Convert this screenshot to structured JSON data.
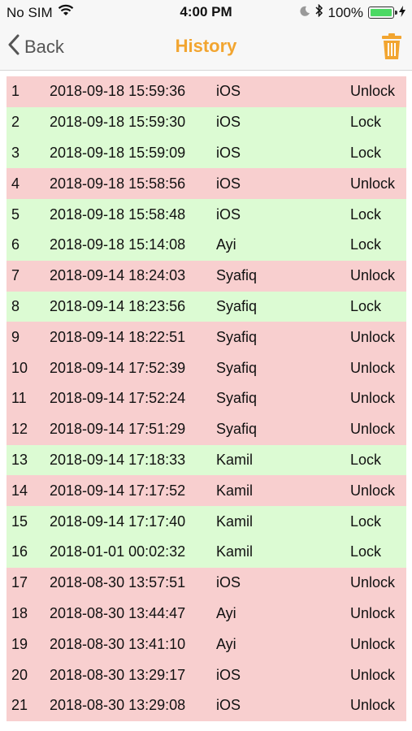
{
  "status_bar": {
    "carrier": "No SIM",
    "time": "4:00 PM",
    "battery": "100%",
    "battery_fill": 1.0
  },
  "nav": {
    "back_label": "Back",
    "title": "History"
  },
  "colors": {
    "accent": "#f2a530",
    "unlock_row": "#f8cfcf",
    "lock_row": "#dcfbd3"
  },
  "rows": [
    {
      "num": "1",
      "datetime": "2018-09-18 15:59:36",
      "user": "iOS",
      "action": "Unlock"
    },
    {
      "num": "2",
      "datetime": "2018-09-18 15:59:30",
      "user": "iOS",
      "action": "Lock"
    },
    {
      "num": "3",
      "datetime": "2018-09-18 15:59:09",
      "user": "iOS",
      "action": "Lock"
    },
    {
      "num": "4",
      "datetime": "2018-09-18 15:58:56",
      "user": "iOS",
      "action": "Unlock"
    },
    {
      "num": "5",
      "datetime": "2018-09-18 15:58:48",
      "user": "iOS",
      "action": "Lock"
    },
    {
      "num": "6",
      "datetime": "2018-09-18 15:14:08",
      "user": "Ayi",
      "action": "Lock"
    },
    {
      "num": "7",
      "datetime": "2018-09-14 18:24:03",
      "user": "Syafiq",
      "action": "Unlock"
    },
    {
      "num": "8",
      "datetime": "2018-09-14 18:23:56",
      "user": "Syafiq",
      "action": "Lock"
    },
    {
      "num": "9",
      "datetime": "2018-09-14 18:22:51",
      "user": "Syafiq",
      "action": "Unlock"
    },
    {
      "num": "10",
      "datetime": "2018-09-14 17:52:39",
      "user": "Syafiq",
      "action": "Unlock"
    },
    {
      "num": "11",
      "datetime": "2018-09-14 17:52:24",
      "user": "Syafiq",
      "action": "Unlock"
    },
    {
      "num": "12",
      "datetime": "2018-09-14 17:51:29",
      "user": "Syafiq",
      "action": "Unlock"
    },
    {
      "num": "13",
      "datetime": "2018-09-14 17:18:33",
      "user": "Kamil",
      "action": "Lock"
    },
    {
      "num": "14",
      "datetime": "2018-09-14 17:17:52",
      "user": "Kamil",
      "action": "Unlock"
    },
    {
      "num": "15",
      "datetime": "2018-09-14 17:17:40",
      "user": "Kamil",
      "action": "Lock"
    },
    {
      "num": "16",
      "datetime": "2018-01-01 00:02:32",
      "user": "Kamil",
      "action": "Lock"
    },
    {
      "num": "17",
      "datetime": "2018-08-30 13:57:51",
      "user": "iOS",
      "action": "Unlock"
    },
    {
      "num": "18",
      "datetime": "2018-08-30 13:44:47",
      "user": "Ayi",
      "action": "Unlock"
    },
    {
      "num": "19",
      "datetime": "2018-08-30 13:41:10",
      "user": "Ayi",
      "action": "Unlock"
    },
    {
      "num": "20",
      "datetime": "2018-08-30 13:29:17",
      "user": "iOS",
      "action": "Unlock"
    },
    {
      "num": "21",
      "datetime": "2018-08-30 13:29:08",
      "user": "iOS",
      "action": "Unlock"
    }
  ]
}
